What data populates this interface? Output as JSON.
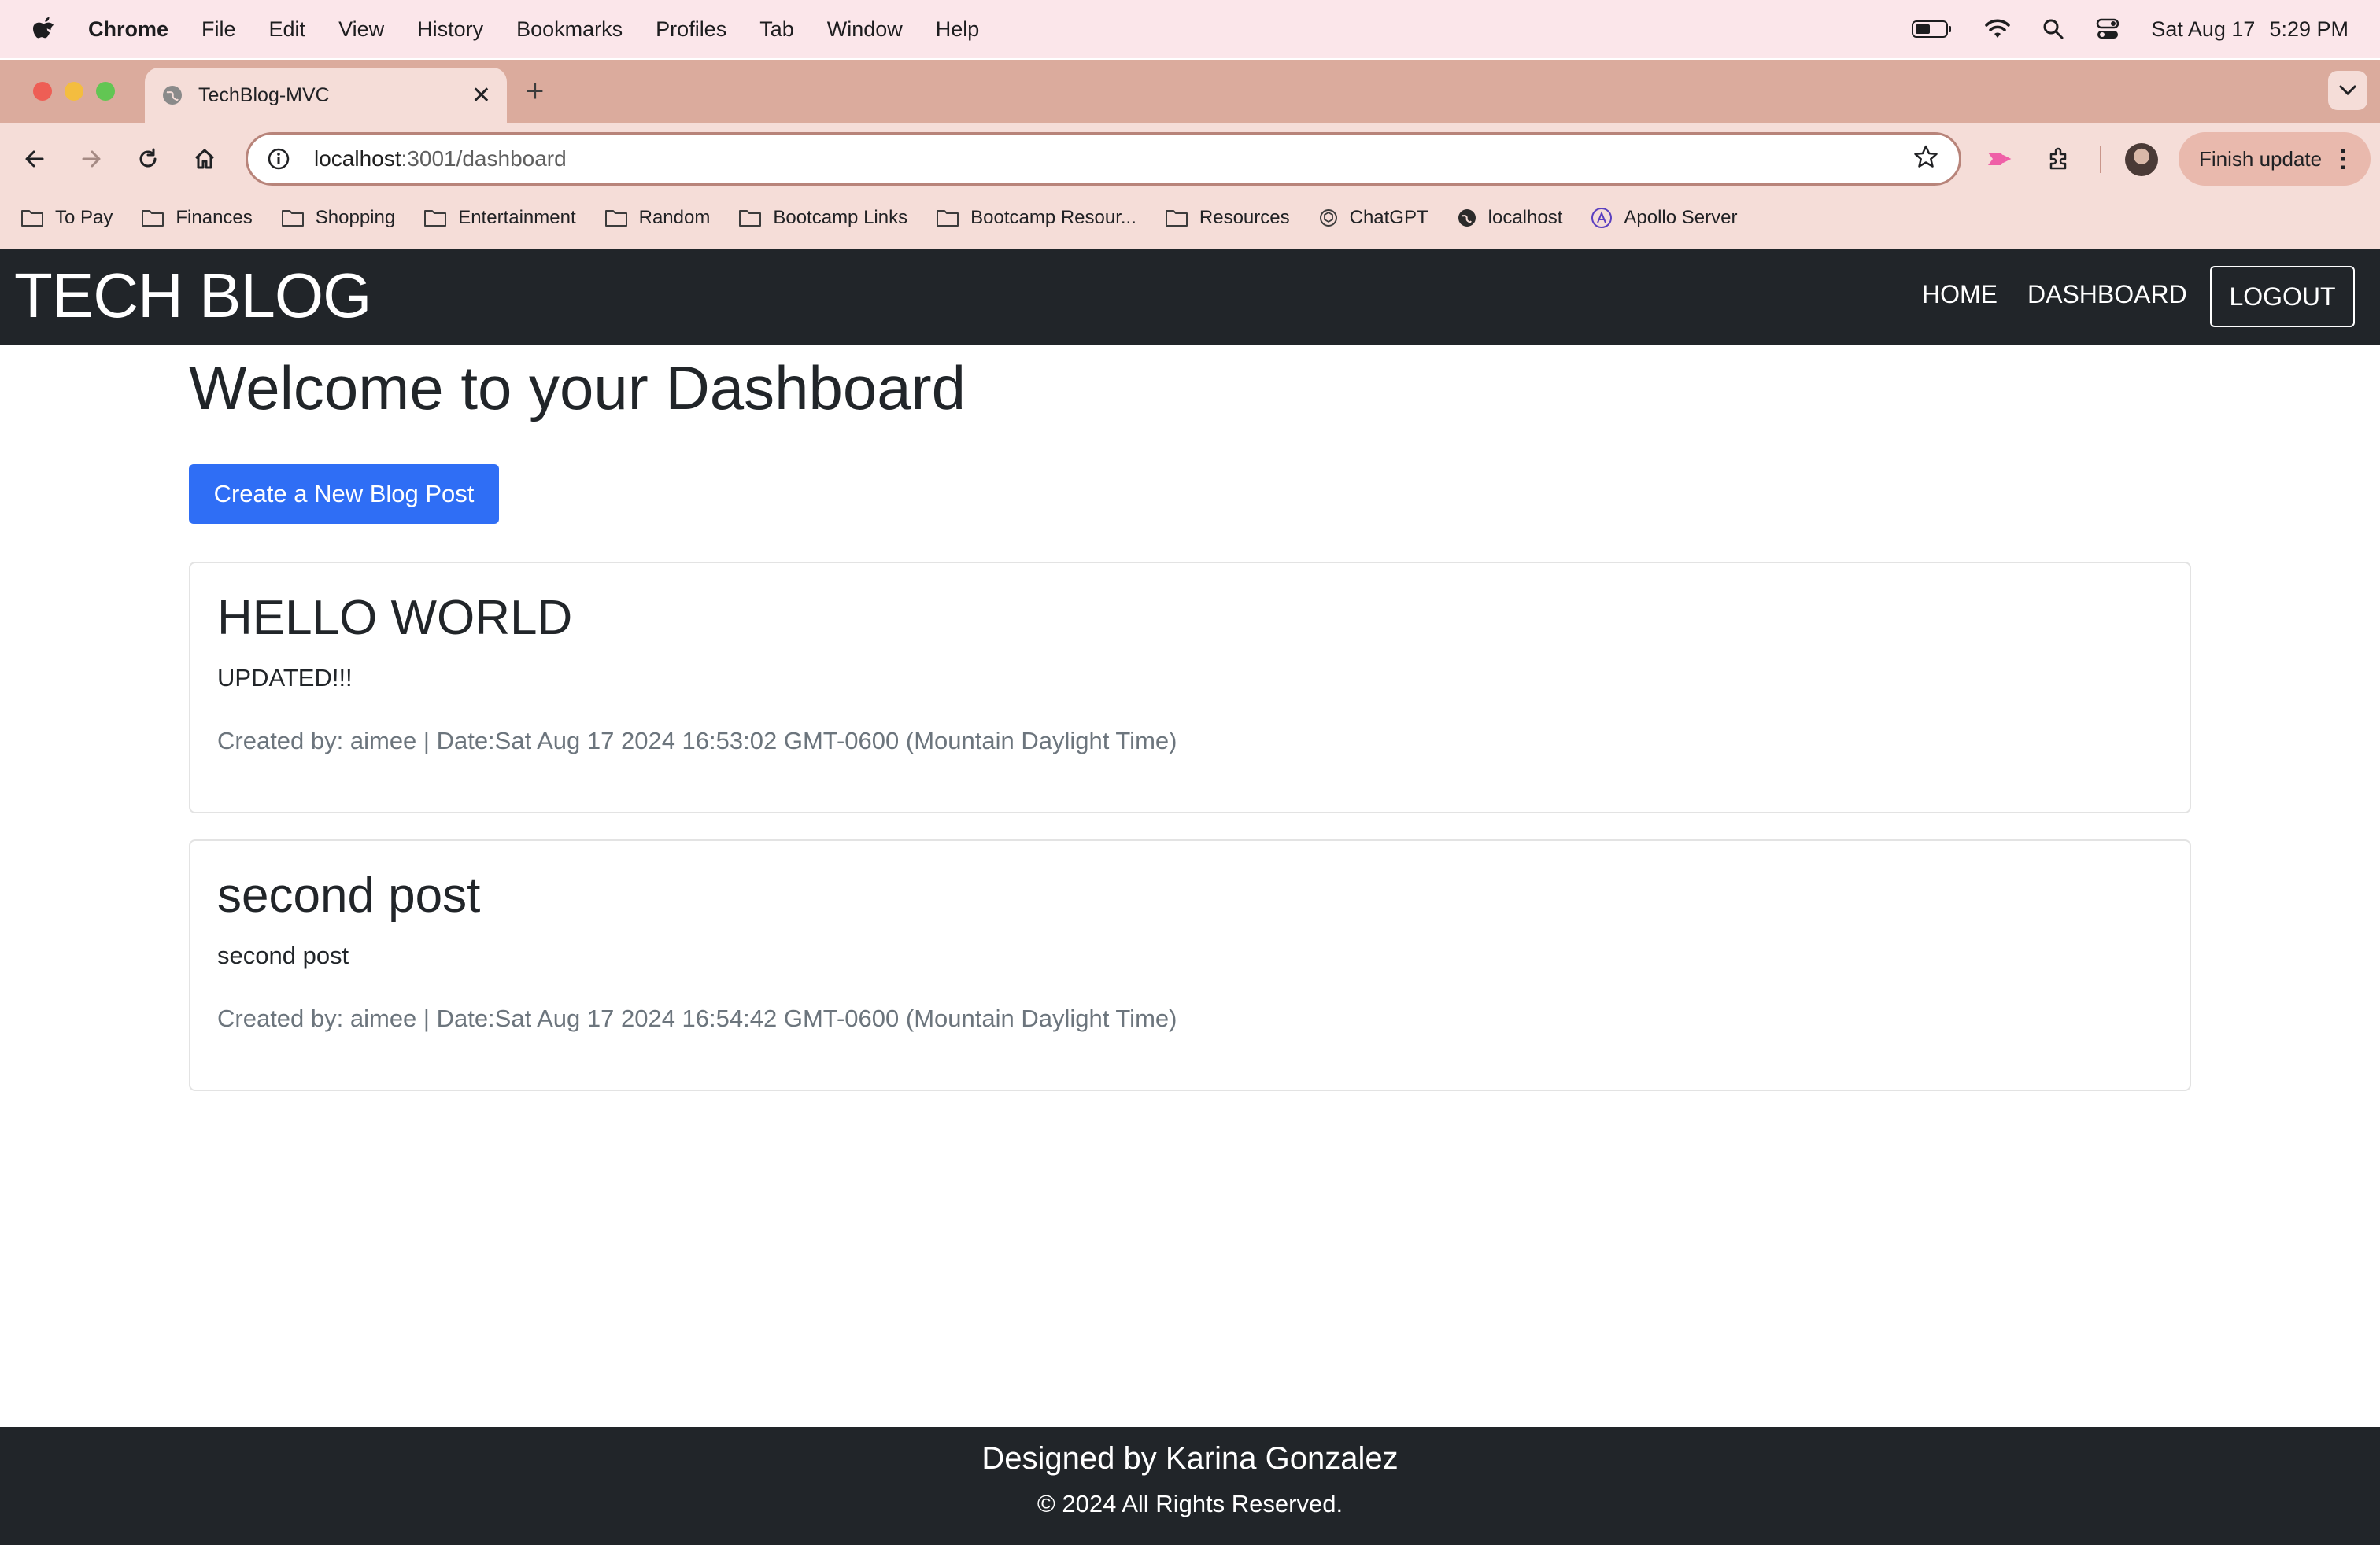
{
  "menubar": {
    "app_name": "Chrome",
    "menus": [
      "File",
      "Edit",
      "View",
      "History",
      "Bookmarks",
      "Profiles",
      "Tab",
      "Window",
      "Help"
    ],
    "date": "Sat Aug 17",
    "time": "5:29 PM"
  },
  "browser": {
    "tab_title": "TechBlog-MVC",
    "url_host": "localhost",
    "url_path": ":3001/dashboard",
    "finish_update_label": "Finish update",
    "bookmarks": [
      {
        "label": "To Pay",
        "icon": "folder-icon"
      },
      {
        "label": "Finances",
        "icon": "folder-icon"
      },
      {
        "label": "Shopping",
        "icon": "folder-icon"
      },
      {
        "label": "Entertainment",
        "icon": "folder-icon"
      },
      {
        "label": "Random",
        "icon": "folder-icon"
      },
      {
        "label": "Bootcamp Links",
        "icon": "folder-icon"
      },
      {
        "label": "Bootcamp Resour...",
        "icon": "folder-icon"
      },
      {
        "label": "Resources",
        "icon": "folder-icon"
      },
      {
        "label": "ChatGPT",
        "icon": "chatgpt-icon"
      },
      {
        "label": "localhost",
        "icon": "globe-icon"
      },
      {
        "label": "Apollo Server",
        "icon": "apollo-icon"
      }
    ]
  },
  "site": {
    "brand": "TECH BLOG",
    "nav": {
      "home": "HOME",
      "dashboard": "DASHBOARD",
      "logout": "LOGOUT"
    },
    "heading": "Welcome to your Dashboard",
    "create_button": "Create a New Blog Post",
    "posts": [
      {
        "title": "HELLO WORLD",
        "body": "UPDATED!!!",
        "meta": "Created by: aimee | Date:Sat Aug 17 2024 16:53:02 GMT-0600 (Mountain Daylight Time)"
      },
      {
        "title": "second post",
        "body": "second post",
        "meta": "Created by: aimee | Date:Sat Aug 17 2024 16:54:42 GMT-0600 (Mountain Daylight Time)"
      }
    ],
    "footer": {
      "designed_by": "Designed by Karina Gonzalez",
      "copyright": "© 2024 All Rights Reserved."
    }
  },
  "colors": {
    "navbar_bg": "#212529",
    "primary_button": "#2f6ef5",
    "menubar_bg": "#fbe6ea",
    "tabstrip_bg": "#dbab9d"
  }
}
